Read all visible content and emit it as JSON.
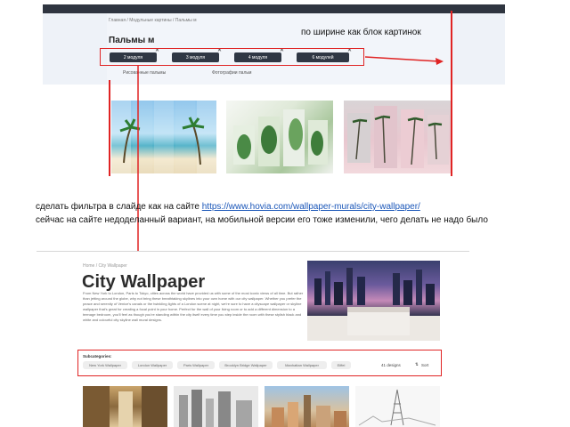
{
  "top_screenshot": {
    "breadcrumb": "Главная / Модульные картины / Пальмы м",
    "title": "Пальмы м",
    "note": "по ширине как блок картинок",
    "tabs": [
      "2 модуля",
      "3 модуля",
      "4 модуля",
      "6 модулей"
    ],
    "sub_links": [
      "Рисованные пальмы",
      "Фотографии пальм"
    ]
  },
  "instructions": {
    "line1_prefix": "сделать фильтра в слайде как на сайте ",
    "line1_link": "https://www.hovia.com/wallpaper-murals/city-wallpaper/",
    "line2": "сейчас на сайте недоделанный вариант, на мобильной версии его тоже изменили, чего делать не надо было"
  },
  "bottom_screenshot": {
    "breadcrumb": "Home / City Wallpaper",
    "title": "City Wallpaper",
    "description": "From New York to London, Paris to Tokyo, cities across the world have provided us with some of the most iconic views of all time. But rather than jetting around the globe, why not bring these breathtaking skylines into your own home with our city wallpaper. Whether you prefer the peace and serenity of Venice's canals or the twinkling lights of a London scene at night, we're sure to have a cityscape wallpaper or skyline wallpaper that's great for creating a focal point in your home. Perfect for the wall of your living room or to add a different dimension to a teenage bedroom, you'll feel as though you're standing within the city itself every time you step inside the room with these stylish black and white and colourful city skyline wall mural designs.",
    "subcategories_label": "Subcategories:",
    "chips": [
      "New York Wallpaper",
      "London Wallpaper",
      "Paris Wallpaper",
      "Brooklyn Bridge Wallpaper",
      "Manhattan Wallpaper",
      "Eiffel"
    ],
    "designs_count": "41 designs",
    "sort_label": "Sort"
  },
  "colors": {
    "annotation_red": "#e02424",
    "tab_dark": "#2f3744",
    "link_blue": "#1a56b8"
  }
}
